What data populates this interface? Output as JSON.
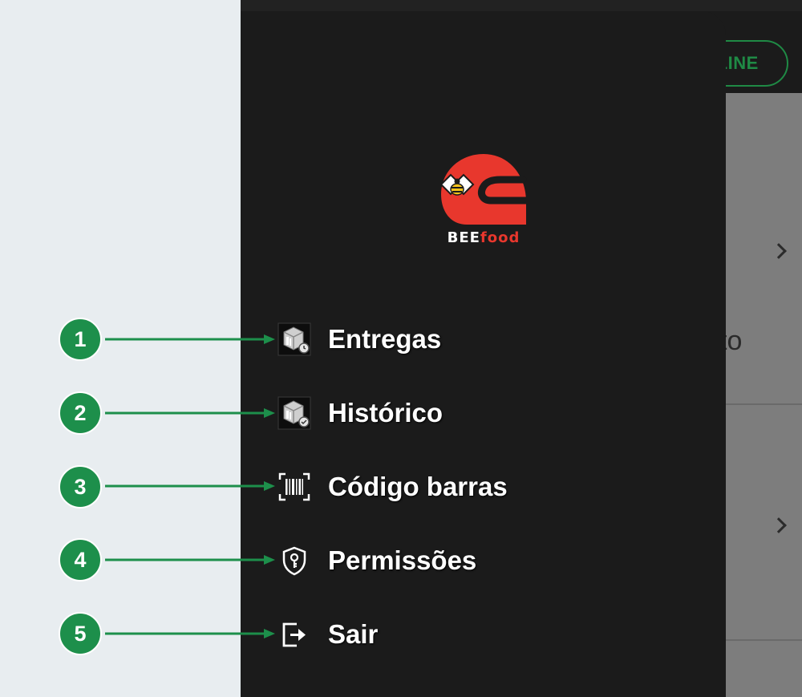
{
  "app": {
    "status_badge": "NLINE",
    "partial_text": "to"
  },
  "drawer": {
    "logo": {
      "brand_prefix": "BEE",
      "brand_suffix": "food"
    },
    "menu": [
      {
        "label": "Entregas",
        "icon": "box-clock-icon"
      },
      {
        "label": "Histórico",
        "icon": "box-check-icon"
      },
      {
        "label": "Código barras",
        "icon": "barcode-scan-icon"
      },
      {
        "label": "Permissões",
        "icon": "shield-key-icon"
      },
      {
        "label": "Sair",
        "icon": "logout-icon"
      }
    ]
  },
  "callouts": [
    "1",
    "2",
    "3",
    "4",
    "5"
  ],
  "colors": {
    "callout": "#1d8f4b",
    "brand_red": "#e8372d",
    "drawer_bg": "#1b1b1b",
    "online_green": "#1f8a45"
  }
}
